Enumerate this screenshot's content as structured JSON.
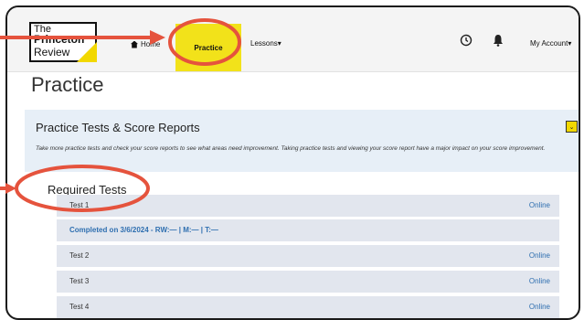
{
  "header": {
    "logo": {
      "line1": "The",
      "line2": "Princeton",
      "line3": "Review"
    },
    "nav": {
      "home": "Home",
      "practice": "Practice",
      "lessons": "Lessons",
      "account": "My Account"
    },
    "icons": {
      "clock": "clock-icon",
      "bell": "bell-icon"
    }
  },
  "page": {
    "title": "Practice"
  },
  "panel": {
    "title": "Practice Tests & Score Reports",
    "description": "Take more practice tests and check your score reports to see what areas need improvement. Taking practice tests and viewing your score report have a major impact on your score improvement.",
    "toggle_icon": "chevron-down-icon"
  },
  "required": {
    "title": "Required Tests",
    "tests": [
      {
        "name": "Test 1",
        "status": "Online"
      },
      {
        "completed": "Completed on 3/6/2024 - RW:— | M:— | T:—"
      },
      {
        "name": "Test 2",
        "status": "Online"
      },
      {
        "name": "Test 3",
        "status": "Online"
      },
      {
        "name": "Test 4",
        "status": "Online"
      }
    ]
  },
  "colors": {
    "accent_yellow": "#f2e21a",
    "annotation": "#e5533d",
    "link_blue": "#2f6fb0"
  }
}
